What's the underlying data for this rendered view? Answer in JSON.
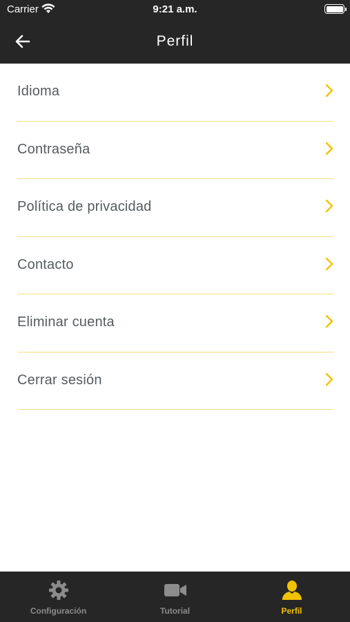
{
  "status_bar": {
    "carrier": "Carrier",
    "time": "9:21 a.m."
  },
  "header": {
    "title": "Perfil",
    "back_icon": "arrow-left-icon"
  },
  "menu": {
    "items": [
      {
        "label": "Idioma"
      },
      {
        "label": "Contraseña"
      },
      {
        "label": "Política de privacidad"
      },
      {
        "label": "Contacto"
      },
      {
        "label": "Eliminar cuenta"
      },
      {
        "label": "Cerrar sesión"
      }
    ],
    "chevron_icon": "chevron-right-icon"
  },
  "tab_bar": {
    "tabs": [
      {
        "label": "Configuración",
        "icon": "gear-icon",
        "active": false
      },
      {
        "label": "Tutorial",
        "icon": "video-camera-icon",
        "active": false
      },
      {
        "label": "Perfil",
        "icon": "person-icon",
        "active": true
      }
    ]
  },
  "colors": {
    "header_bg": "#262626",
    "accent": "#f2c200",
    "divider": "#f3df7e",
    "text": "#555b5e",
    "tab_inactive": "#8c8c8c"
  }
}
